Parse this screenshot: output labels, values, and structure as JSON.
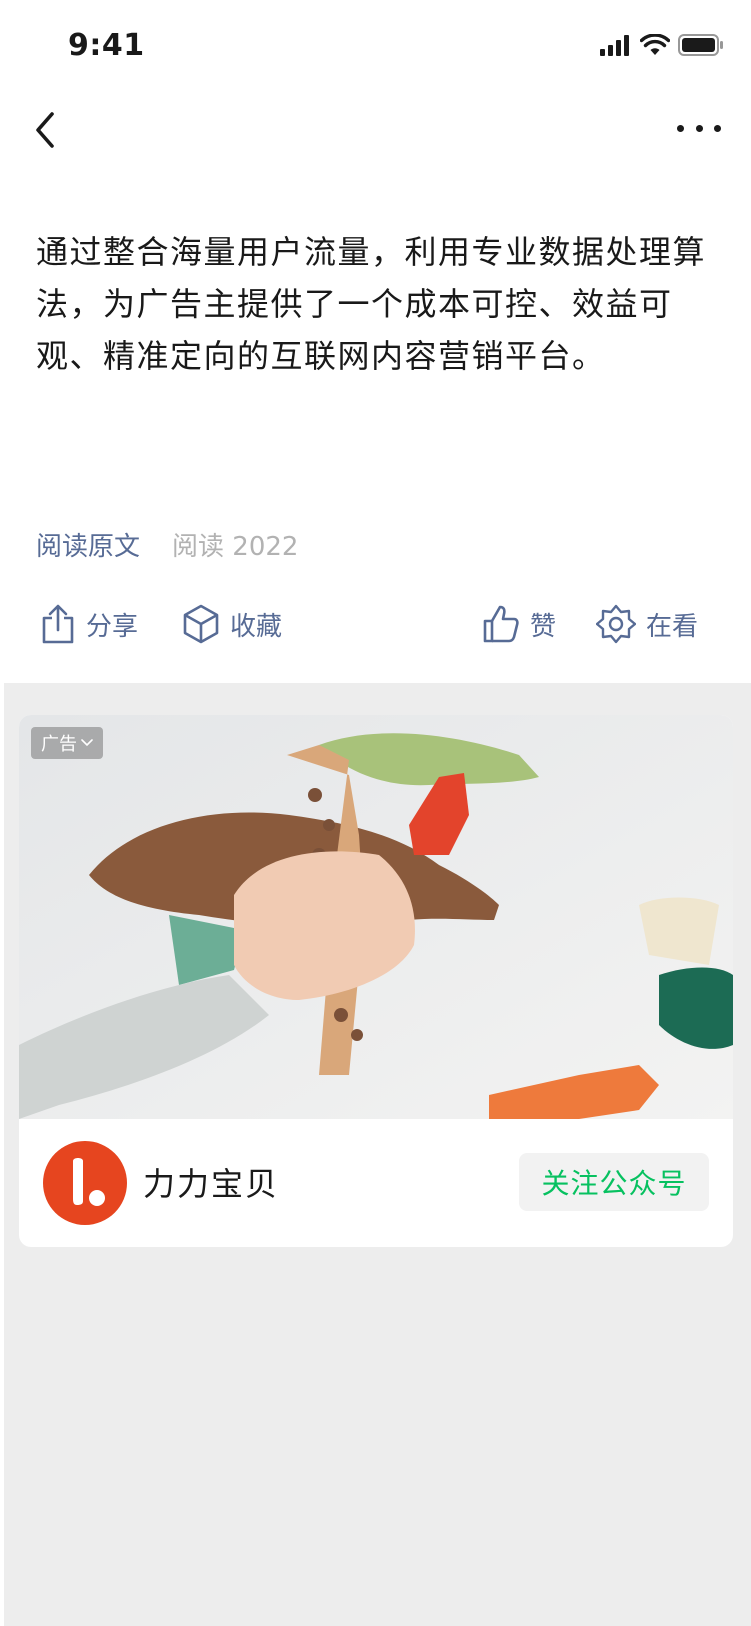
{
  "status_bar": {
    "time": "9:41"
  },
  "article": {
    "text": "通过整合海量用户流量，利用专业数据处理算法，为广告主提供了一个成本可控、效益可观、精准定向的互联网内容营销平台。",
    "read_original": "阅读原文",
    "read_label": "阅读",
    "read_count": "2022"
  },
  "actions": {
    "share": "分享",
    "favorite": "收藏",
    "like": "赞",
    "wow": "在看"
  },
  "ad": {
    "badge": "广告",
    "brand_name": "力力宝贝",
    "follow_label": "关注公众号"
  },
  "colors": {
    "link": "#576b95",
    "follow_green": "#07c160",
    "brand": "#e6451f",
    "feed_background": "#ededed"
  }
}
